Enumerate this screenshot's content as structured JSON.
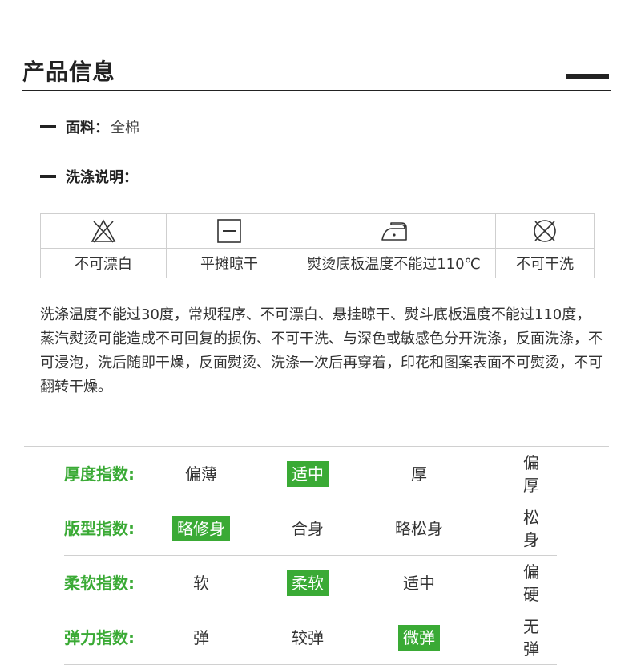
{
  "header": {
    "title": "产品信息"
  },
  "fabric": {
    "label": "面料：",
    "value": "全棉"
  },
  "washing": {
    "label": "洗涤说明："
  },
  "care": {
    "items": [
      {
        "icon": "no-bleach-icon",
        "label": "不可漂白"
      },
      {
        "icon": "dry-flat-icon",
        "label": "平摊晾干"
      },
      {
        "icon": "iron-low-icon",
        "label": "熨烫底板温度不能过110℃"
      },
      {
        "icon": "no-dry-clean-icon",
        "label": "不可干洗"
      }
    ],
    "description": "洗涤温度不能过30度，常规程序、不可漂白、悬挂晾干、熨斗底板温度不能过110度，蒸汽熨烫可能造成不可回复的损伤、不可干洗、与深色或敏感色分开洗涤，反面洗涤，不可浸泡，洗后随即干燥，反面熨烫、洗涤一次后再穿着，印花和图案表面不可熨烫，不可翻转干燥。"
  },
  "indices": [
    {
      "label": "厚度指数:",
      "options": [
        "偏薄",
        "适中",
        "厚",
        "偏厚"
      ],
      "selected": 1
    },
    {
      "label": "版型指数:",
      "options": [
        "略修身",
        "合身",
        "略松身",
        "松身"
      ],
      "selected": 0
    },
    {
      "label": "柔软指数:",
      "options": [
        "软",
        "柔软",
        "适中",
        "偏硬"
      ],
      "selected": 1
    },
    {
      "label": "弹力指数:",
      "options": [
        "弹",
        "较弹",
        "微弹",
        "无弹"
      ],
      "selected": 2
    }
  ],
  "colors": {
    "accent": "#3aaa35",
    "text": "#333333",
    "rule": "#222222"
  }
}
